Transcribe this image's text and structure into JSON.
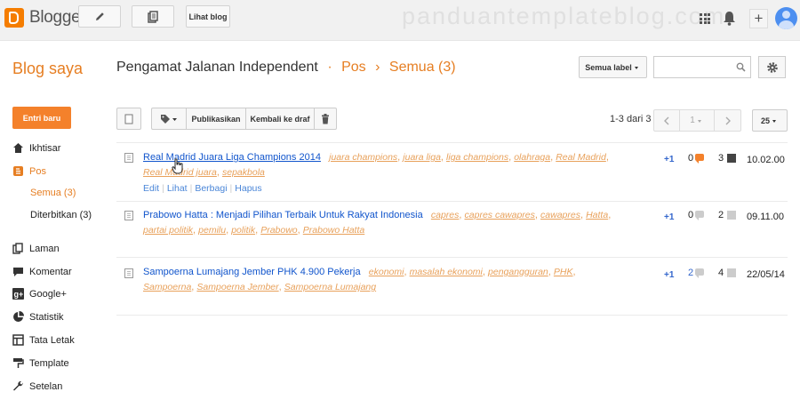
{
  "app": {
    "name": "Blogger",
    "view_blog": "Lihat blog",
    "watermark": "panduantemplateblog.com"
  },
  "header": {
    "my_blogs": "Blog saya",
    "blog_name": "Pengamat Jalanan Independent",
    "dot": "·",
    "section": "Pos",
    "arrow": "›",
    "filter": "Semua (3)",
    "label_dropdown": "Semua label",
    "search_placeholder": ""
  },
  "sidebar": {
    "new_post": "Entri baru",
    "items": [
      {
        "label": "Ikhtisar",
        "icon": "home-icon"
      },
      {
        "label": "Pos",
        "icon": "posts-icon"
      },
      {
        "label": "Laman",
        "icon": "pages-icon"
      },
      {
        "label": "Komentar",
        "icon": "comment-icon"
      },
      {
        "label": "Google+",
        "icon": "google-plus-icon"
      },
      {
        "label": "Statistik",
        "icon": "pie-chart-icon"
      },
      {
        "label": "Tata Letak",
        "icon": "layout-icon"
      },
      {
        "label": "Template",
        "icon": "paint-roller-icon"
      },
      {
        "label": "Setelan",
        "icon": "wrench-icon"
      }
    ],
    "sub_items": [
      {
        "label": "Semua (3)"
      },
      {
        "label": "Diterbitkan (3)"
      }
    ]
  },
  "toolbar": {
    "publish": "Publikasikan",
    "revert_draft": "Kembali ke draf",
    "count": "1-3 dari 3",
    "page": "1",
    "per_page": "25"
  },
  "posts": [
    {
      "title": "Real Madrid Juara Liga Champions 2014",
      "labels": [
        "juara champions",
        "juara liga",
        "liga champions",
        "olahraga",
        "Real Madrid",
        "Real Madrid juara",
        "sepakbola"
      ],
      "actions": {
        "edit": "Edit",
        "view": "Lihat",
        "share": "Berbagi",
        "delete": "Hapus"
      },
      "plusone": "+1",
      "comments": "0",
      "views": "3",
      "date": "10.02.00"
    },
    {
      "title": "Prabowo Hatta : Menjadi Pilihan Terbaik Untuk Rakyat Indonesia",
      "labels": [
        "capres",
        "capres cawapres",
        "cawapres",
        "Hatta",
        "partai politik",
        "pemilu",
        "politik",
        "Prabowo",
        "Prabowo Hatta"
      ],
      "plusone": "+1",
      "comments": "0",
      "views": "2",
      "date": "09.11.00"
    },
    {
      "title": "Sampoerna Lumajang Jember PHK 4.900 Pekerja",
      "labels": [
        "ekonomi",
        "masalah ekonomi",
        "pengangguran",
        "PHK",
        "Sampoerna",
        "Sampoerna Jember",
        "Sampoerna Lumajang"
      ],
      "plusone": "+1",
      "comments": "2",
      "views": "4",
      "date": "22/05/14"
    }
  ],
  "colors": {
    "accent": "#e67e22",
    "button_orange": "#f4812b",
    "link_blue": "#1155cc",
    "label_orange": "#e8a15b"
  }
}
